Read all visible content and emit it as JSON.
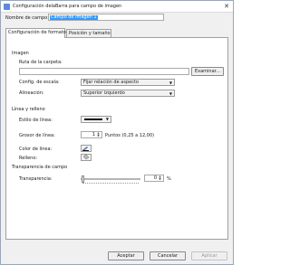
{
  "window": {
    "title": "Configuración delaBarra para campo de imagen",
    "close_glyph": "✕"
  },
  "name_field": {
    "label": "Nombre de campo:",
    "value": "Campo de imagen 1"
  },
  "tabs": [
    {
      "label": "Configuración de formato",
      "active": true
    },
    {
      "label": "Posición y tamaño",
      "active": false
    }
  ],
  "image_section": {
    "heading": "Imagen",
    "folder_label": "Ruta de la carpeta:",
    "folder_value": "",
    "browse_label": "Examinar...",
    "scale_label": "Config. de escala:",
    "scale_value": "Fijar relación de aspecto",
    "align_label": "Alineación:",
    "align_value": "Superior izquierdo"
  },
  "line_section": {
    "heading": "Línea y relleno",
    "style_label": "Estilo de línea:",
    "width_label": "Grosor de línea:",
    "width_value": "1",
    "width_units": "Puntos (0,25 a 12,00)",
    "color_label": "Color de línea:",
    "fill_label": "Relleno:"
  },
  "transparency_section": {
    "heading": "Transparencia de campo",
    "label": "Transparencia:",
    "value": "0",
    "units": "%"
  },
  "buttons": {
    "accept": "Aceptar",
    "cancel": "Cancelar",
    "apply": "Aplicar"
  },
  "icons": {
    "window": "window-icon",
    "close": "close-icon",
    "combo_arrow": "▼",
    "spin_up": "▲",
    "spin_down": "▼"
  }
}
